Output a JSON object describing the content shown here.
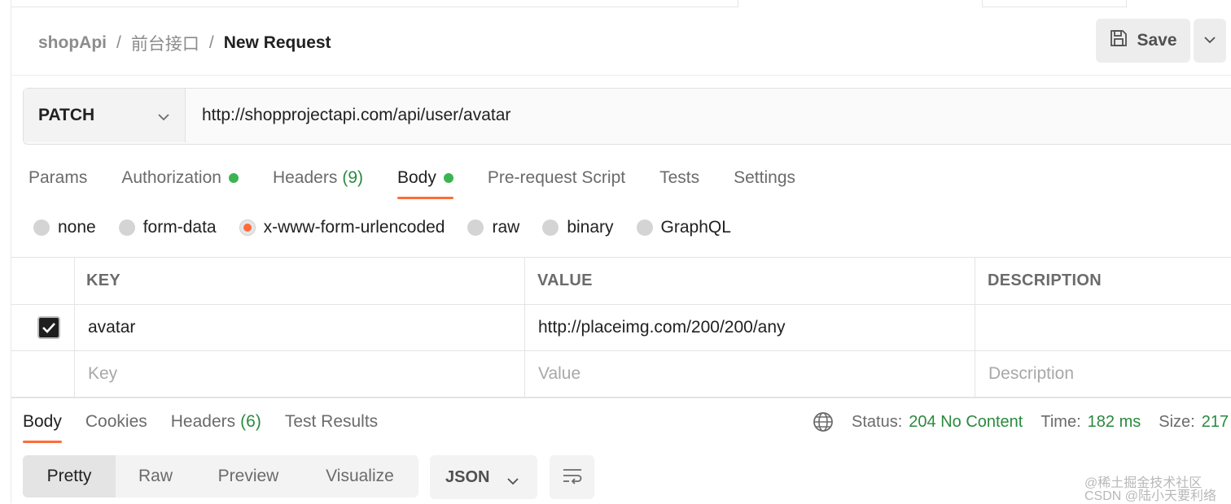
{
  "breadcrumb": {
    "collection": "shopApi",
    "folder": "前台接口",
    "request": "New Request",
    "separator": "/"
  },
  "save": {
    "label": "Save",
    "icon": "save-icon",
    "menu_icon": "chevron-down-icon"
  },
  "request": {
    "method": "PATCH",
    "url": "http://shopprojectapi.com/api/user/avatar"
  },
  "request_tabs": [
    {
      "label": "Params",
      "count": "",
      "dot": false,
      "active": false
    },
    {
      "label": "Authorization",
      "count": "",
      "dot": true,
      "active": false
    },
    {
      "label": "Headers",
      "count": "(9)",
      "dot": false,
      "active": false
    },
    {
      "label": "Body",
      "count": "",
      "dot": true,
      "active": true
    },
    {
      "label": "Pre-request Script",
      "count": "",
      "dot": false,
      "active": false
    },
    {
      "label": "Tests",
      "count": "",
      "dot": false,
      "active": false
    },
    {
      "label": "Settings",
      "count": "",
      "dot": false,
      "active": false
    }
  ],
  "body_types": [
    {
      "label": "none",
      "selected": false
    },
    {
      "label": "form-data",
      "selected": false
    },
    {
      "label": "x-www-form-urlencoded",
      "selected": true
    },
    {
      "label": "raw",
      "selected": false
    },
    {
      "label": "binary",
      "selected": false
    },
    {
      "label": "GraphQL",
      "selected": false
    }
  ],
  "table": {
    "headers": {
      "key": "KEY",
      "value": "VALUE",
      "description": "DESCRIPTION"
    },
    "rows": [
      {
        "checked": true,
        "key": "avatar",
        "value": "http://placeimg.com/200/200/any",
        "description": ""
      }
    ],
    "placeholders": {
      "key": "Key",
      "value": "Value",
      "description": "Description"
    }
  },
  "response_tabs": [
    {
      "label": "Body",
      "count": "",
      "active": true
    },
    {
      "label": "Cookies",
      "count": "",
      "active": false
    },
    {
      "label": "Headers",
      "count": "(6)",
      "active": false
    },
    {
      "label": "Test Results",
      "count": "",
      "active": false
    }
  ],
  "response_status": {
    "status_label": "Status:",
    "status_value": "204 No Content",
    "time_label": "Time:",
    "time_value": "182 ms",
    "size_label": "Size:",
    "size_value": "217"
  },
  "formats": [
    "Pretty",
    "Raw",
    "Preview",
    "Visualize"
  ],
  "active_format": "Pretty",
  "language": "JSON",
  "watermark": {
    "line1": "@稀土掘金技术社区",
    "line2": "CSDN @陆小天要利络"
  },
  "colors": {
    "accent": "#ff6c37",
    "green": "#2a8a3e",
    "dot_green": "#3cb451"
  }
}
